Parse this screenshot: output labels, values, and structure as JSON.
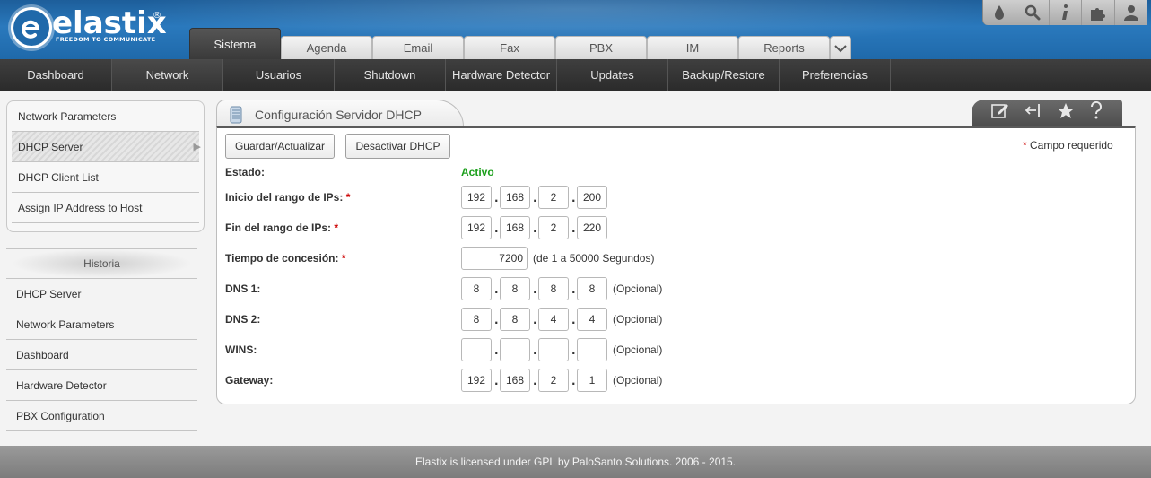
{
  "brand": {
    "name": "elastix",
    "registered": "®",
    "tagline": "FREEDOM TO COMMUNICATE",
    "accent": "#2a79bd"
  },
  "top_icons": [
    "drop-icon",
    "search-icon",
    "info-icon",
    "puzzle-icon",
    "user-icon"
  ],
  "main_tabs": [
    {
      "label": "Sistema",
      "active": true
    },
    {
      "label": "Agenda"
    },
    {
      "label": "Email"
    },
    {
      "label": "Fax"
    },
    {
      "label": "PBX"
    },
    {
      "label": "IM"
    },
    {
      "label": "Reports"
    }
  ],
  "subnav": [
    {
      "label": "Dashboard"
    },
    {
      "label": "Network",
      "active": true
    },
    {
      "label": "Usuarios"
    },
    {
      "label": "Shutdown"
    },
    {
      "label": "Hardware Detector"
    },
    {
      "label": "Updates"
    },
    {
      "label": "Backup/Restore"
    },
    {
      "label": "Preferencias"
    }
  ],
  "sidebar": {
    "items": [
      {
        "label": "Network Parameters"
      },
      {
        "label": "DHCP Server",
        "active": true
      },
      {
        "label": "DHCP Client List"
      },
      {
        "label": "Assign IP Address to Host"
      }
    ],
    "history_title": "Historia",
    "history": [
      {
        "label": "DHCP Server"
      },
      {
        "label": "Network Parameters"
      },
      {
        "label": "Dashboard"
      },
      {
        "label": "Hardware Detector"
      },
      {
        "label": "PBX Configuration"
      }
    ]
  },
  "panel": {
    "title": "Configuración Servidor DHCP",
    "tools": [
      "edit-icon",
      "collapse-icon",
      "star-icon",
      "help-icon"
    ],
    "save_label": "Guardar/Actualizar",
    "deactivate_label": "Desactivar DHCP",
    "required_mark": "*",
    "required_note": "Campo requerido"
  },
  "form": {
    "estado_label": "Estado:",
    "estado_value": "Activo",
    "estado_color": "#1a9f1a",
    "range_start_label": "Inicio del rango de IPs:",
    "range_start": [
      "192",
      "168",
      "2",
      "200"
    ],
    "range_end_label": "Fin del rango de IPs:",
    "range_end": [
      "192",
      "168",
      "2",
      "220"
    ],
    "lease_label": "Tiempo de concesión:",
    "lease_value": "7200",
    "lease_hint": "(de 1 a 50000 Segundos)",
    "dns1_label": "DNS 1:",
    "dns1": [
      "8",
      "8",
      "8",
      "8"
    ],
    "dns2_label": "DNS 2:",
    "dns2": [
      "8",
      "8",
      "4",
      "4"
    ],
    "wins_label": "WINS:",
    "wins": [
      "",
      "",
      "",
      ""
    ],
    "gateway_label": "Gateway:",
    "gateway": [
      "192",
      "168",
      "2",
      "1"
    ],
    "optional_hint": "(Opcional)",
    "dot": "."
  },
  "footer": {
    "text": "Elastix is licensed under GPL by PaloSanto Solutions. 2006 - 2015."
  }
}
